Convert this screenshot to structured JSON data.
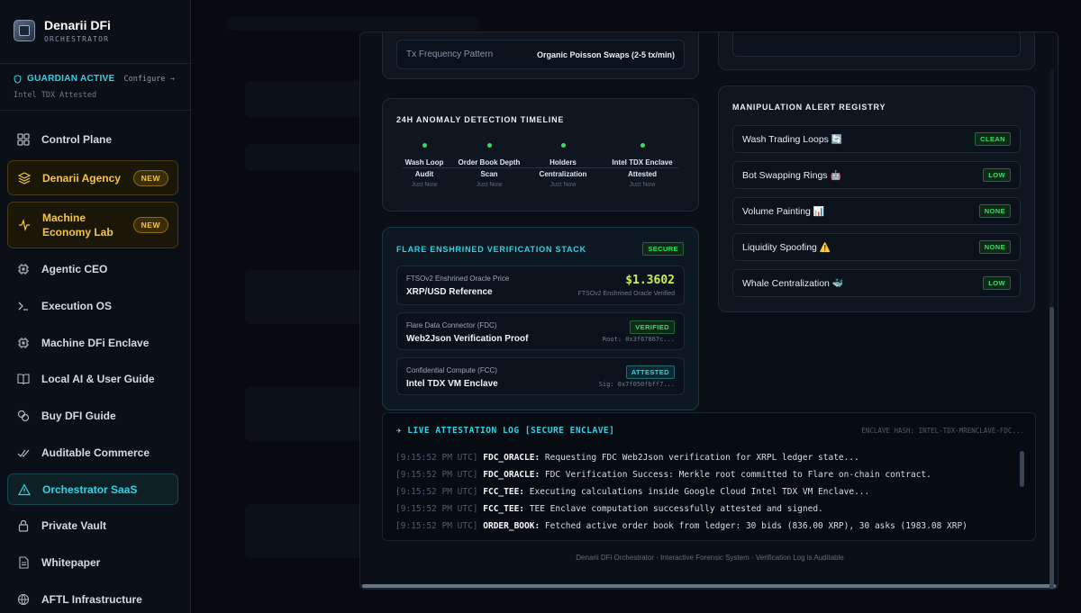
{
  "brand": {
    "title": "Denarii DFi",
    "subtitle": "ORCHESTRATOR"
  },
  "guardian": {
    "status": "GUARDIAN ACTIVE",
    "configure": "Configure →",
    "attestation": "Intel TDX Attested"
  },
  "nav": [
    {
      "label": "Control Plane",
      "icon": "grid-icon"
    },
    {
      "label": "Denarii Agency",
      "icon": "layers-icon",
      "badge": "NEW"
    },
    {
      "label": "Machine Economy Lab",
      "icon": "pulse-icon",
      "badge": "NEW"
    },
    {
      "label": "Agentic CEO",
      "icon": "chip-icon"
    },
    {
      "label": "Execution OS",
      "icon": "terminal-icon"
    },
    {
      "label": "Machine DFi Enclave",
      "icon": "chip-icon"
    },
    {
      "label": "Local AI & User Guide",
      "icon": "book-icon"
    },
    {
      "label": "Buy DFI Guide",
      "icon": "coins-icon"
    },
    {
      "label": "Auditable Commerce",
      "icon": "check-icon"
    },
    {
      "label": "Orchestrator SaaS",
      "icon": "warning-icon"
    },
    {
      "label": "Private Vault",
      "icon": "lock-icon"
    },
    {
      "label": "Whitepaper",
      "icon": "document-icon"
    },
    {
      "label": "AFTL Infrastructure",
      "icon": "globe-icon"
    }
  ],
  "tx": {
    "label": "Tx Frequency Pattern",
    "value": "Organic Poisson Swaps (2-5 tx/min)"
  },
  "timeline": {
    "title": "24H ANOMALY DETECTION TIMELINE",
    "items": [
      {
        "line1": "Wash Loop",
        "line2": "Audit",
        "time": "Just Now"
      },
      {
        "line1": "Order Book Depth",
        "line2": "Scan",
        "time": "Just Now"
      },
      {
        "line1": "Holders",
        "line2": "Centralization",
        "time": "Just Now"
      },
      {
        "line1": "Intel TDX Enclave",
        "line2": "Attested",
        "time": "Just Now"
      }
    ]
  },
  "flare": {
    "title": "FLARE ENSHRINED VERIFICATION STACK",
    "status": "SECURE",
    "items": [
      {
        "small": "FTSOv2 Enshrined Oracle Price",
        "big": "XRP/USD Reference",
        "value": "$1.3602",
        "note": "FTSOv2 Enshrined Oracle Verified"
      },
      {
        "small": "Flare Data Connector (FDC)",
        "big": "Web2Json Verification Proof",
        "tag": "VERIFIED",
        "note": "Root: 0x3f67867c..."
      },
      {
        "small": "Confidential Compute (FCC)",
        "big": "Intel TDX VM Enclave",
        "tag": "ATTESTED",
        "note": "Sig: 0x7f050fbff7..."
      }
    ]
  },
  "alerts": {
    "title": "MANIPULATION ALERT REGISTRY",
    "items": [
      {
        "name": "Wash Trading Loops",
        "emoji": "🔄",
        "level": "CLEAN"
      },
      {
        "name": "Bot Swapping Rings",
        "emoji": "🤖",
        "level": "LOW"
      },
      {
        "name": "Volume Painting",
        "emoji": "📊",
        "level": "NONE"
      },
      {
        "name": "Liquidity Spoofing",
        "emoji": "⚠️",
        "level": "NONE"
      },
      {
        "name": "Whale Centralization",
        "emoji": "🐳",
        "level": "LOW"
      }
    ]
  },
  "log": {
    "title": "LIVE ATTESTATION LOG [SECURE ENCLAVE]",
    "hash": "ENCLAVE HASH: INTEL-TDX-MRENCLAVE-FDC...",
    "lines": [
      {
        "ts": "[9:15:52 PM UTC]",
        "src": "FDC_ORACLE:",
        "msg": "Requesting FDC Web2Json verification for XRPL ledger state..."
      },
      {
        "ts": "[9:15:52 PM UTC]",
        "src": "FDC_ORACLE:",
        "msg": "FDC Verification Success: Merkle root committed to Flare on-chain contract."
      },
      {
        "ts": "[9:15:52 PM UTC]",
        "src": "FCC_TEE:",
        "msg": "Executing calculations inside Google Cloud Intel TDX VM Enclave..."
      },
      {
        "ts": "[9:15:52 PM UTC]",
        "src": "FCC_TEE:",
        "msg": "TEE Enclave computation successfully attested and signed."
      },
      {
        "ts": "[9:15:52 PM UTC]",
        "src": "ORDER_BOOK:",
        "msg": "Fetched active order book from ledger: 30 bids (836.00 XRP), 30 asks (1983.08 XRP)"
      }
    ]
  },
  "footer": "Denarii DFi Orchestrator · Interactive Forensic System · Verification Log is Auditable"
}
